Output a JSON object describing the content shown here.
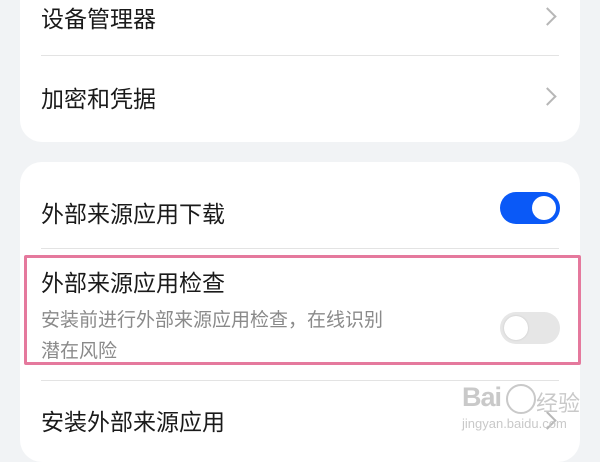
{
  "group1": {
    "items": [
      {
        "label": "设备管理器"
      },
      {
        "label": "加密和凭据"
      }
    ]
  },
  "group2": {
    "download": {
      "label": "外部来源应用下载",
      "enabled": true
    },
    "check": {
      "label": "外部来源应用检查",
      "description_line1": "安装前进行外部来源应用检查，在线识别",
      "description_line2": "潜在风险",
      "enabled": false
    },
    "install": {
      "label": "安装外部来源应用"
    }
  },
  "colors": {
    "accent": "#0a59f7",
    "highlight_border": "#e5799d",
    "background": "#f1f3f5"
  },
  "watermark": {
    "brand": "Bai",
    "brand_cn": "经验",
    "url": "jingyan.baidu.com"
  }
}
